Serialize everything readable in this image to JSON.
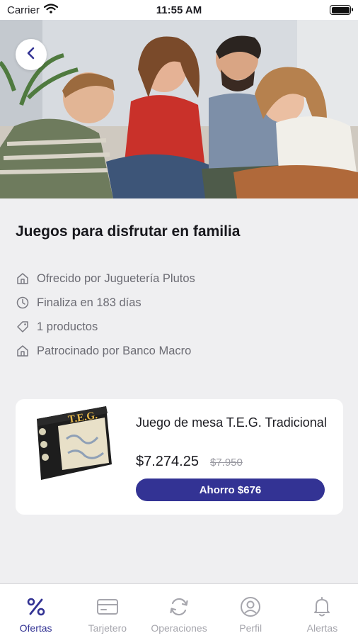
{
  "status_bar": {
    "carrier": "Carrier",
    "time": "11:55 AM"
  },
  "offer": {
    "title": "Juegos para disfrutar en familia",
    "info": [
      {
        "icon": "store-icon",
        "text": "Ofrecido por Juguetería Plutos"
      },
      {
        "icon": "clock-icon",
        "text": "Finaliza en 183 días"
      },
      {
        "icon": "tag-icon",
        "text": "1 productos"
      },
      {
        "icon": "store-icon",
        "text": "Patrocinado por Banco Macro"
      }
    ]
  },
  "product": {
    "name": "Juego de mesa T.E.G. Tradicional",
    "price": "$7.274.25",
    "old_price": "$7.950",
    "savings": "Ahorro $676",
    "box_label": "T.E.G."
  },
  "tabs": [
    {
      "label": "Ofertas",
      "icon": "percent-icon",
      "active": true
    },
    {
      "label": "Tarjetero",
      "icon": "card-icon",
      "active": false
    },
    {
      "label": "Operaciones",
      "icon": "refresh-icon",
      "active": false
    },
    {
      "label": "Perfil",
      "icon": "user-icon",
      "active": false
    },
    {
      "label": "Alertas",
      "icon": "bell-icon",
      "active": false
    }
  ],
  "colors": {
    "accent": "#333394",
    "background": "#efeff1",
    "inactive": "#a6a6ad"
  }
}
